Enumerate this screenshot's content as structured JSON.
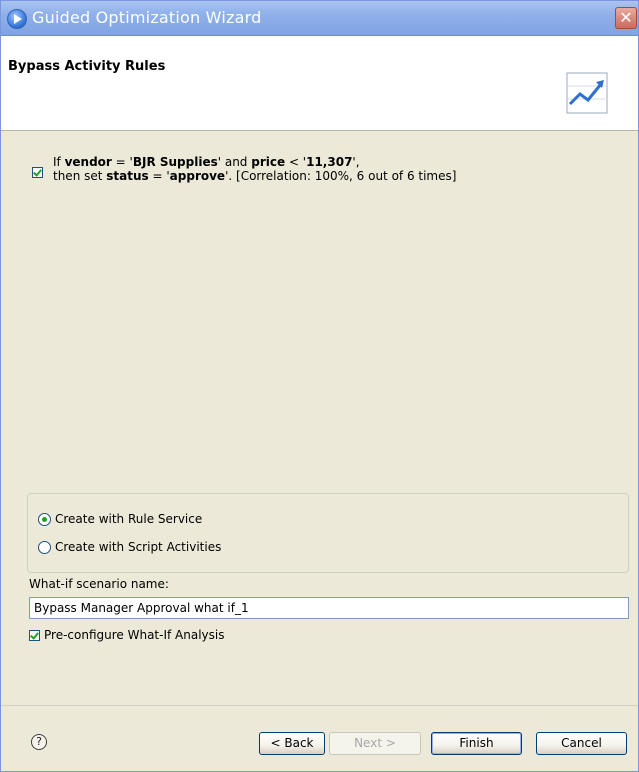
{
  "window": {
    "title": "Guided Optimization Wizard",
    "close_glyph": "✕"
  },
  "banner": {
    "title": "Bypass Activity Rules",
    "graphic": "trend-chart-icon"
  },
  "rule": {
    "checked": true,
    "line1_prefix": "If ",
    "line1_field1": "vendor",
    "line1_eq1": " = '",
    "line1_value1": "BJR Supplies",
    "line1_mid": "' and ",
    "line1_field2": "price",
    "line1_lt": " < '",
    "line1_value2": "11,307",
    "line1_suffix": "',",
    "line2_prefix": "then set ",
    "line2_field": "status",
    "line2_eq": " = '",
    "line2_value": "approve",
    "line2_suffix": "'. [Correlation: 100%, 6 out of 6 times]"
  },
  "options": {
    "rule_service_label": "Create with Rule Service",
    "script_activities_label": "Create with Script Activities",
    "selected": "rule_service"
  },
  "whatif": {
    "label": "What-if scenario name:",
    "value": "Bypass Manager Approval what if_1",
    "preconfigure_label": "Pre-configure What-If Analysis",
    "preconfigure_checked": true
  },
  "footer": {
    "help_glyph": "?",
    "back_label": "< Back",
    "next_label": "Next >",
    "finish_label": "Finish",
    "cancel_label": "Cancel"
  },
  "colors": {
    "accent_check": "#21a121",
    "titlebar": "#8fb0ea",
    "background": "#ece9d8"
  }
}
